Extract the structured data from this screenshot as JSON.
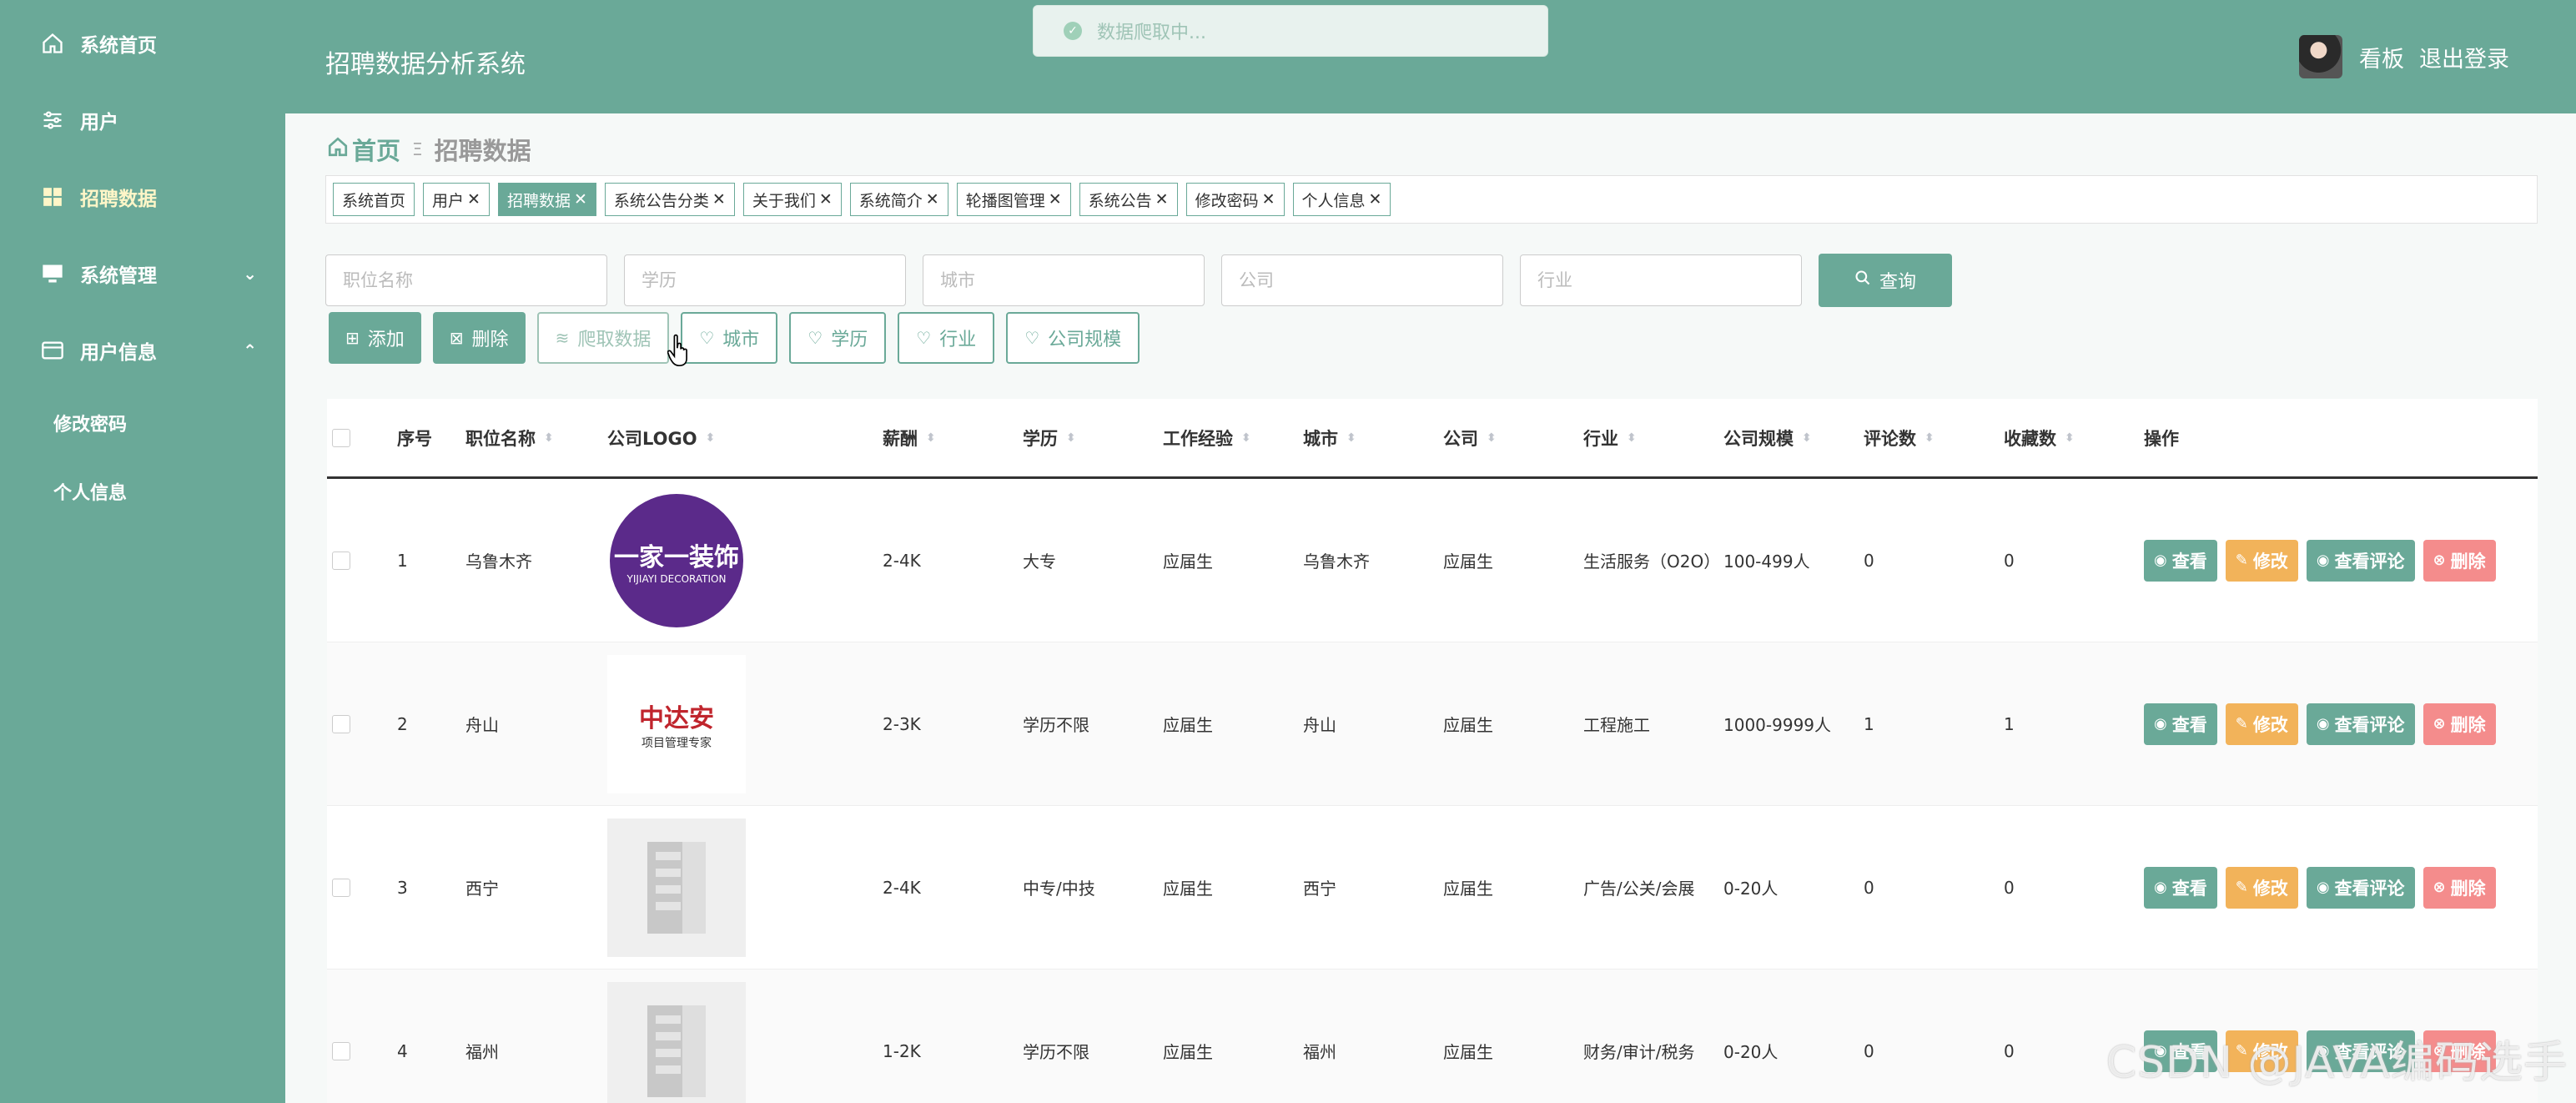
{
  "sidebar": {
    "items": [
      {
        "label": "系统首页",
        "icon": "home-icon"
      },
      {
        "label": "用户",
        "icon": "sliders-icon"
      },
      {
        "label": "招聘数据",
        "icon": "grid-icon"
      },
      {
        "label": "系统管理",
        "icon": "monitor-icon"
      },
      {
        "label": "用户信息",
        "icon": "card-icon"
      }
    ],
    "subitems": [
      {
        "label": "修改密码"
      },
      {
        "label": "个人信息"
      }
    ]
  },
  "header": {
    "title": "招聘数据分析系统",
    "dashboard": "看板",
    "logout": "退出登录"
  },
  "toast": {
    "text": "数据爬取中..."
  },
  "breadcrumb": {
    "home": "首页",
    "current": "招聘数据"
  },
  "tags": [
    {
      "label": "系统首页",
      "closable": false
    },
    {
      "label": "用户",
      "closable": true
    },
    {
      "label": "招聘数据",
      "closable": true
    },
    {
      "label": "系统公告分类",
      "closable": true
    },
    {
      "label": "关于我们",
      "closable": true
    },
    {
      "label": "系统简介",
      "closable": true
    },
    {
      "label": "轮播图管理",
      "closable": true
    },
    {
      "label": "系统公告",
      "closable": true
    },
    {
      "label": "修改密码",
      "closable": true
    },
    {
      "label": "个人信息",
      "closable": true
    }
  ],
  "search": {
    "job_placeholder": "职位名称",
    "edu_placeholder": "学历",
    "city_placeholder": "城市",
    "company_placeholder": "公司",
    "industry_placeholder": "行业",
    "query_label": "查询"
  },
  "actions": {
    "add": "添加",
    "delete": "删除",
    "crawl": "爬取数据",
    "city": "城市",
    "education": "学历",
    "industry": "行业",
    "company_size": "公司规模"
  },
  "table": {
    "headers": [
      "序号",
      "职位名称",
      "公司LOGO",
      "薪酬",
      "学历",
      "工作经验",
      "城市",
      "公司",
      "行业",
      "公司规模",
      "评论数",
      "收藏数",
      "操作"
    ],
    "rows": [
      {
        "idx": "1",
        "job": "乌鲁木齐",
        "salary": "2-4K",
        "edu": "大专",
        "exp": "应届生",
        "city": "乌鲁木齐",
        "company": "应届生",
        "industry": "生活服务（O2O）",
        "size": "100-499人",
        "comments": "0",
        "favorites": "0"
      },
      {
        "idx": "2",
        "job": "舟山",
        "salary": "2-3K",
        "edu": "学历不限",
        "exp": "应届生",
        "city": "舟山",
        "company": "应届生",
        "industry": "工程施工",
        "size": "1000-9999人",
        "comments": "1",
        "favorites": "1"
      },
      {
        "idx": "3",
        "job": "西宁",
        "salary": "2-4K",
        "edu": "中专/中技",
        "exp": "应届生",
        "city": "西宁",
        "company": "应届生",
        "industry": "广告/公关/会展",
        "size": "0-20人",
        "comments": "0",
        "favorites": "0"
      },
      {
        "idx": "4",
        "job": "福州",
        "salary": "1-2K",
        "edu": "学历不限",
        "exp": "应届生",
        "city": "福州",
        "company": "应届生",
        "industry": "财务/审计/税务",
        "size": "0-20人",
        "comments": "0",
        "favorites": "0"
      }
    ],
    "ops": {
      "view": "查看",
      "edit": "修改",
      "comments": "查看评论",
      "delete": "删除"
    }
  },
  "logos": {
    "row1_name": "一家一装饰",
    "row1_en": "YIJIAYI DECORATION",
    "row2_name": "中达安",
    "row2_sub": "项目管理专家"
  },
  "watermark": "CSDN @JAVA编码选手"
}
